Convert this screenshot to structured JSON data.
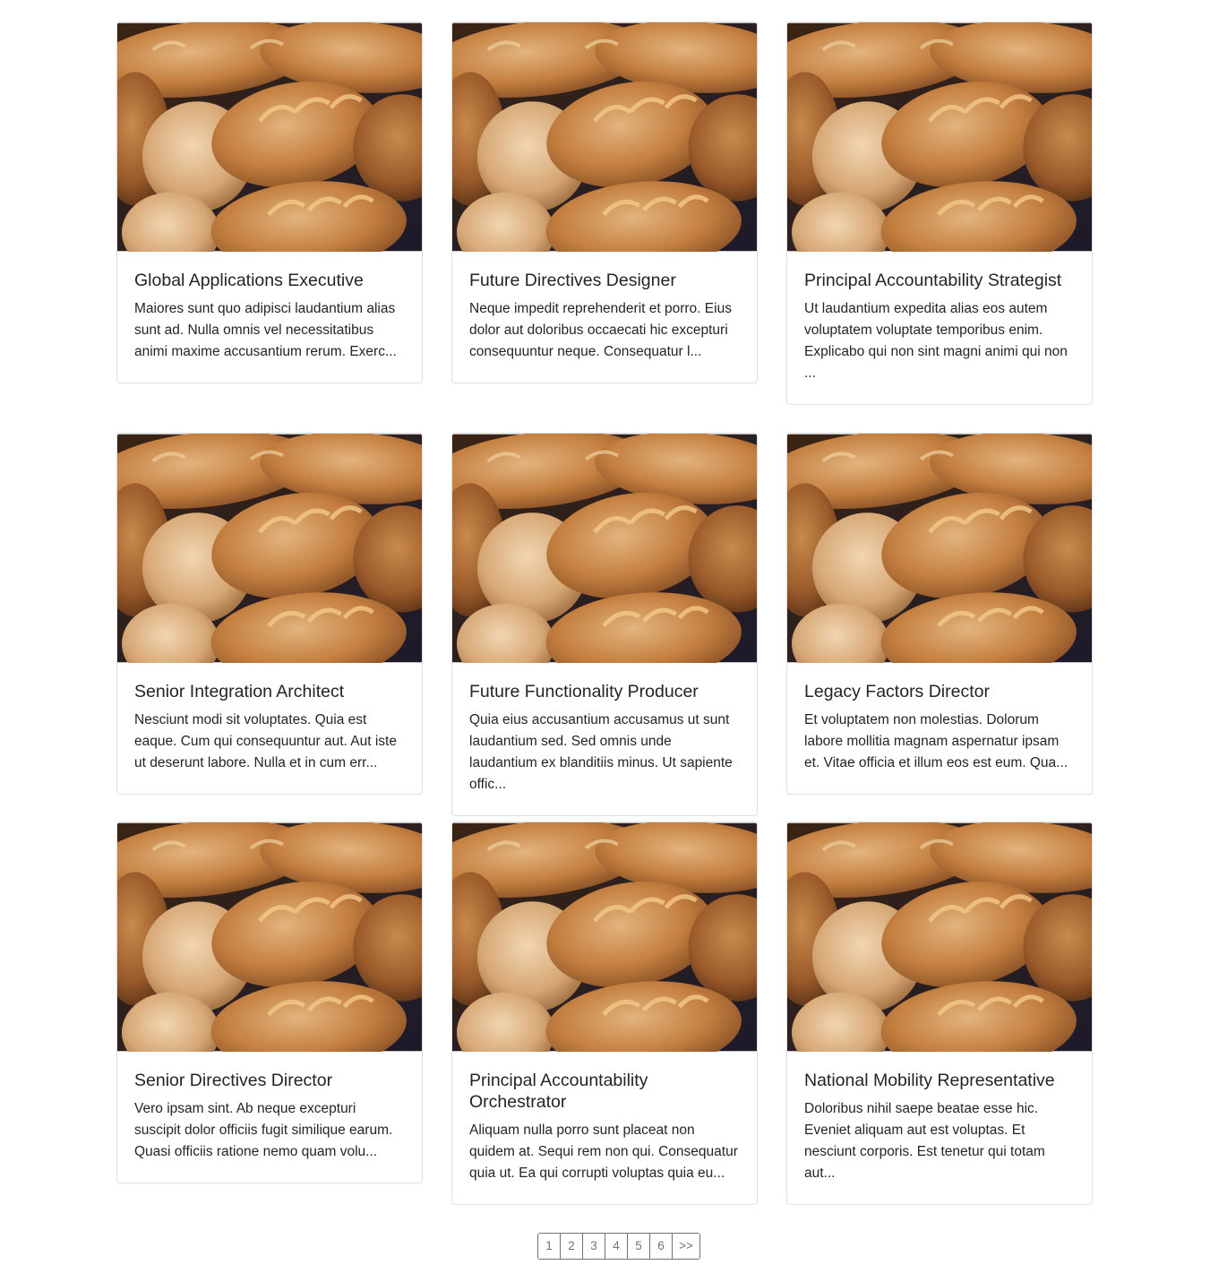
{
  "cards": [
    {
      "title": "Global Applications Executive",
      "text": "Maiores sunt quo adipisci laudantium alias sunt ad. Nulla omnis vel necessitatibus animi maxime accusantium rerum. Exerc..."
    },
    {
      "title": "Future Directives Designer",
      "text": "Neque impedit reprehenderit et porro. Eius dolor aut doloribus occaecati hic excepturi consequuntur neque. Consequatur l..."
    },
    {
      "title": "Principal Accountability Strategist",
      "text": "Ut laudantium expedita alias eos autem voluptatem voluptate temporibus enim. Explicabo qui non sint magni animi qui non ..."
    },
    {
      "title": "Senior Integration Architect",
      "text": "Nesciunt modi sit voluptates. Quia est eaque. Cum qui consequuntur aut. Aut iste ut deserunt labore. Nulla et in cum err..."
    },
    {
      "title": "Future Functionality Producer",
      "text": "Quia eius accusantium accusamus ut sunt laudantium sed. Sed omnis unde laudantium ex blanditiis minus. Ut sapiente offic..."
    },
    {
      "title": "Legacy Factors Director",
      "text": "Et voluptatem non molestias. Dolorum labore mollitia magnam aspernatur ipsam et. Vitae officia et illum eos est eum. Qua..."
    },
    {
      "title": "Senior Directives Director",
      "text": "Vero ipsam sint. Ab neque excepturi suscipit dolor officiis fugit similique earum. Quasi officiis ratione nemo quam volu..."
    },
    {
      "title": "Principal Accountability Orchestrator",
      "text": "Aliquam nulla porro sunt placeat non quidem at. Sequi rem non qui. Consequatur quia ut. Ea qui corrupti voluptas quia eu..."
    },
    {
      "title": "National Mobility Representative",
      "text": "Doloribus nihil saepe beatae esse hic. Eveniet aliquam aut est voluptas. Et nesciunt corporis. Est tenetur qui totam aut..."
    }
  ],
  "pagination": [
    "1",
    "2",
    "3",
    "4",
    "5",
    "6",
    ">>"
  ]
}
